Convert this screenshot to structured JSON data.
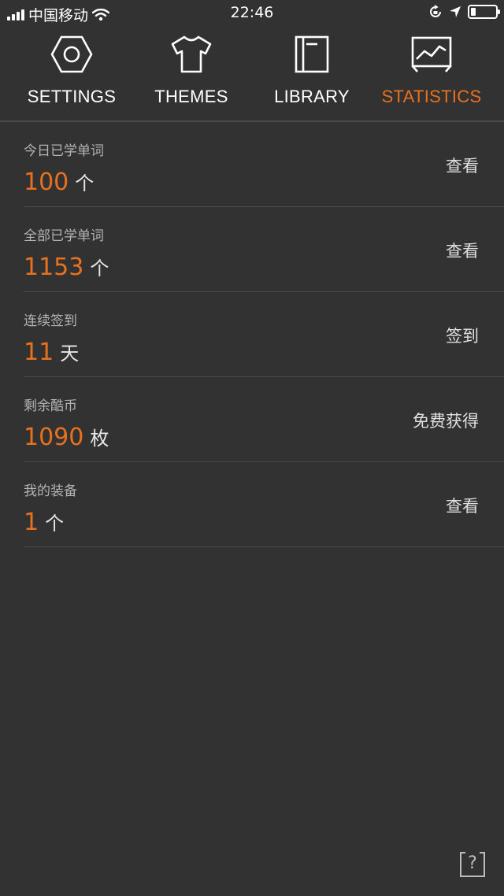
{
  "status_bar": {
    "carrier": "中国移动",
    "time": "22:46"
  },
  "tabs": [
    {
      "label": "SETTINGS",
      "icon": "hexagon-nut-icon",
      "active": false
    },
    {
      "label": "THEMES",
      "icon": "tshirt-icon",
      "active": false
    },
    {
      "label": "LIBRARY",
      "icon": "book-icon",
      "active": false
    },
    {
      "label": "STATISTICS",
      "icon": "chart-icon",
      "active": true
    }
  ],
  "colors": {
    "accent": "#e8711e",
    "background": "#333233",
    "divider": "#4a494a"
  },
  "stats": [
    {
      "title": "今日已学单词",
      "value": "100",
      "unit": "个",
      "action": "查看"
    },
    {
      "title": "全部已学单词",
      "value": "1153",
      "unit": "个",
      "action": "查看"
    },
    {
      "title": "连续签到",
      "value": "11",
      "unit": "天",
      "action": "签到"
    },
    {
      "title": "剩余酷币",
      "value": "1090",
      "unit": "枚",
      "action": "免费获得"
    },
    {
      "title": "我的装备",
      "value": "1",
      "unit": "个",
      "action": "查看"
    }
  ],
  "help": {
    "glyph": "?",
    "icon": "help-icon"
  }
}
